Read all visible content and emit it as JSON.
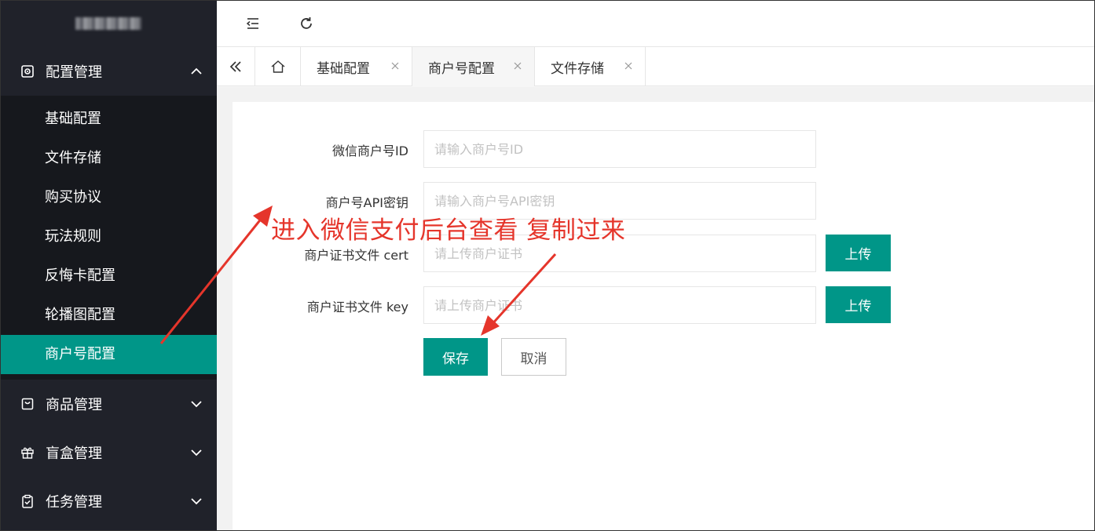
{
  "sidebar": {
    "logo_text": "",
    "groups": [
      {
        "label": "配置管理",
        "icon": "settings-icon",
        "expanded": true
      },
      {
        "label": "商品管理",
        "icon": "bag-icon",
        "expanded": false
      },
      {
        "label": "盲盒管理",
        "icon": "gift-icon",
        "expanded": false
      },
      {
        "label": "任务管理",
        "icon": "clipboard-icon",
        "expanded": false
      }
    ],
    "config_items": [
      {
        "label": "基础配置"
      },
      {
        "label": "文件存储"
      },
      {
        "label": "购买协议"
      },
      {
        "label": "玩法规则"
      },
      {
        "label": "反悔卡配置"
      },
      {
        "label": "轮播图配置"
      },
      {
        "label": "商户号配置",
        "active": true
      }
    ]
  },
  "topbar": {
    "collapse_icon": "indent-icon",
    "refresh_icon": "refresh-icon"
  },
  "tabs": {
    "nav_icon": "double-chevron-left-icon",
    "home_icon": "home-icon",
    "items": [
      {
        "label": "基础配置"
      },
      {
        "label": "商户号配置",
        "active": true
      },
      {
        "label": "文件存储"
      }
    ]
  },
  "form": {
    "mch_id": {
      "label": "微信商户号ID",
      "placeholder": "请输入商户号ID",
      "value": ""
    },
    "api_key": {
      "label": "商户号API密钥",
      "placeholder": "请输入商户号API密钥",
      "value": ""
    },
    "cert": {
      "label": "商户证书文件 cert",
      "placeholder": "请上传商户证书",
      "value": "",
      "upload_label": "上传"
    },
    "key": {
      "label": "商户证书文件 key",
      "placeholder": "请上传商户证书",
      "value": "",
      "upload_label": "上传"
    },
    "save_label": "保存",
    "cancel_label": "取消"
  },
  "annotation": {
    "text": "进入微信支付后台查看 复制过来",
    "color": "#e5352b"
  },
  "colors": {
    "accent": "#009688",
    "sidebar_bg": "#20222a",
    "submenu_bg": "#16181d"
  }
}
